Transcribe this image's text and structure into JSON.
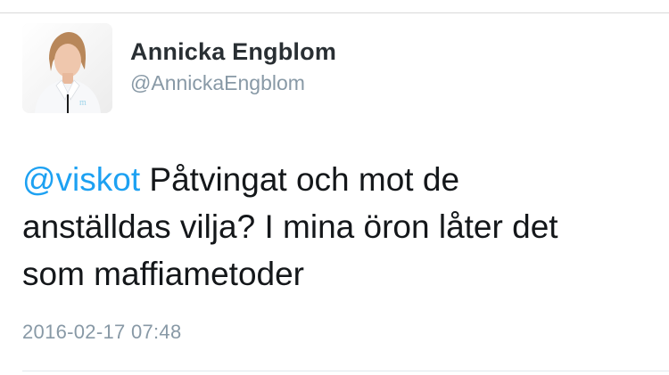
{
  "tweet": {
    "author": {
      "display_name": "Annicka Engblom",
      "screen_name": "@AnnickaEngblom",
      "avatar_icon": "profile-photo"
    },
    "text": {
      "mention": "@viskot",
      "line1_rest": " Påtvingat och mot de",
      "line2": "anställdas vilja? I mina öron låter det",
      "line3": "som maffiametoder"
    },
    "timestamp": "2016-02-17 07:48"
  },
  "colors": {
    "mention": "#1da1f2",
    "secondary_text": "#8899a6",
    "primary_text": "#14171a",
    "divider": "#e1e8ed"
  }
}
